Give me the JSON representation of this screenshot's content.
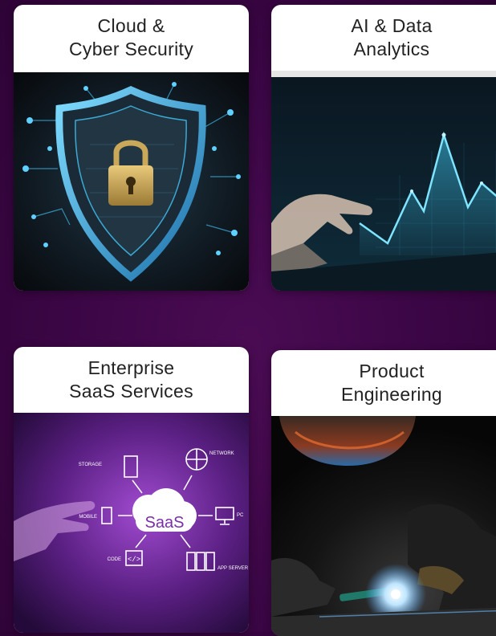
{
  "cards": [
    {
      "title": "Cloud &\nCyber Security",
      "image": "shield-padlock-icon"
    },
    {
      "title": "AI & Data\nAnalytics",
      "image": "hand-touching-graph-icon"
    },
    {
      "title": "Enterprise\nSaaS Services",
      "image": "saas-cloud-diagram-icon"
    },
    {
      "title": "Product\nEngineering",
      "image": "welding-icon"
    }
  ],
  "saas_diagram": {
    "center": "SaaS",
    "labels": {
      "storage": "STORAGE",
      "network": "NETWORK",
      "mobile": "MOBILE",
      "pc": "PC",
      "code": "CODE",
      "app_server": "APP SERVER"
    }
  },
  "colors": {
    "background": "#3a0644",
    "card_header": "#ffffff",
    "title_text": "#222222",
    "cyber_blue": "#3fb8e8",
    "saas_purple": "#7a2fa8"
  }
}
